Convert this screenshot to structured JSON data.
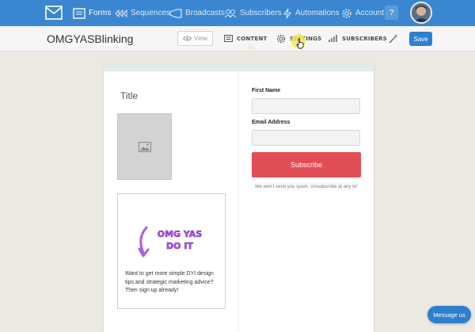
{
  "nav": {
    "items": [
      {
        "label": "Forms",
        "icon": "forms-icon"
      },
      {
        "label": "Sequences",
        "icon": "sequences-icon"
      },
      {
        "label": "Broadcasts",
        "icon": "broadcasts-icon"
      },
      {
        "label": "Subscribers",
        "icon": "subscribers-icon"
      },
      {
        "label": "Automations",
        "icon": "automations-icon"
      },
      {
        "label": "Account",
        "icon": "gear-icon"
      }
    ],
    "help_label": "?"
  },
  "subbar": {
    "form_name": "OMGYASBlinking",
    "view_label": "View",
    "tabs": [
      {
        "label": "CONTENT",
        "icon": "content-icon"
      },
      {
        "label": "SETTINGS",
        "icon": "gear-icon"
      },
      {
        "label": "SUBSCRIBERS",
        "icon": "bar-chart-icon"
      }
    ],
    "save_label": "Save"
  },
  "form": {
    "title": "Title",
    "promo_art_text": "OMG YAS DO IT",
    "promo_text": "Want to get more simple DYI design tips and strategic marketing advice? Then sign up already!",
    "fields": [
      {
        "label": "First Name",
        "value": ""
      },
      {
        "label": "Email Address",
        "value": ""
      }
    ],
    "subscribe_label": "Subscribe",
    "fine_print": "We won't send you spam. Unsubscribe at any time."
  },
  "chat": {
    "label": "Message us"
  },
  "colors": {
    "nav": "#3a86d0",
    "subscribe": "#e14e56",
    "save": "#2f7fcf",
    "promo_purple": "#b05ce0"
  }
}
